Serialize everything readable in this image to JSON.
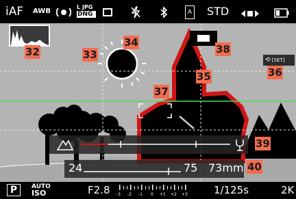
{
  "top_bar": {
    "focus_mode": "iAF",
    "white_balance": "AWB",
    "metering_icon": "metering-icon",
    "file_format_top": "L JPG",
    "file_format_bottom": "DNG",
    "drive_mode_icon": "drive-mode-icon",
    "flash_icon": "flash-off-icon",
    "bluetooth_icon": "bluetooth-icon",
    "stabilization_icon": "stabilization-icon",
    "stabilization_letters": "A",
    "user_profile": "STD",
    "exposure_indicator_icon": "exposure-compensation-icon",
    "battery_icon": "battery-icon"
  },
  "callouts": [
    "32",
    "33",
    "34",
    "35",
    "36",
    "37",
    "38",
    "39",
    "40"
  ],
  "overlays": {
    "histogram_icon": "histogram-icon",
    "sun_icon": "sun-icon",
    "flash_preview_icon": "flash-preview-icon",
    "orientation_badge": "[SET]",
    "af_field_icon": "af-field-icon",
    "landscape_icon": "landscape-icon",
    "macro_icon": "macro-icon"
  },
  "zoom_scale": {
    "min": "24",
    "mid": "75",
    "current": "73mm"
  },
  "bottom_bar": {
    "mode": "P",
    "iso_top": "AUTO",
    "iso_bottom": "ISO",
    "aperture": "F2.8",
    "scale_labels": [
      "-3",
      "-2",
      "-1",
      "0",
      "+1",
      "+2",
      "+3"
    ],
    "shutter": "1/125s",
    "remaining": "2K"
  },
  "colors": {
    "highlight_red": "#d11616",
    "callout_bg": "#f26c4f",
    "horizon_green": "#46e05a"
  }
}
